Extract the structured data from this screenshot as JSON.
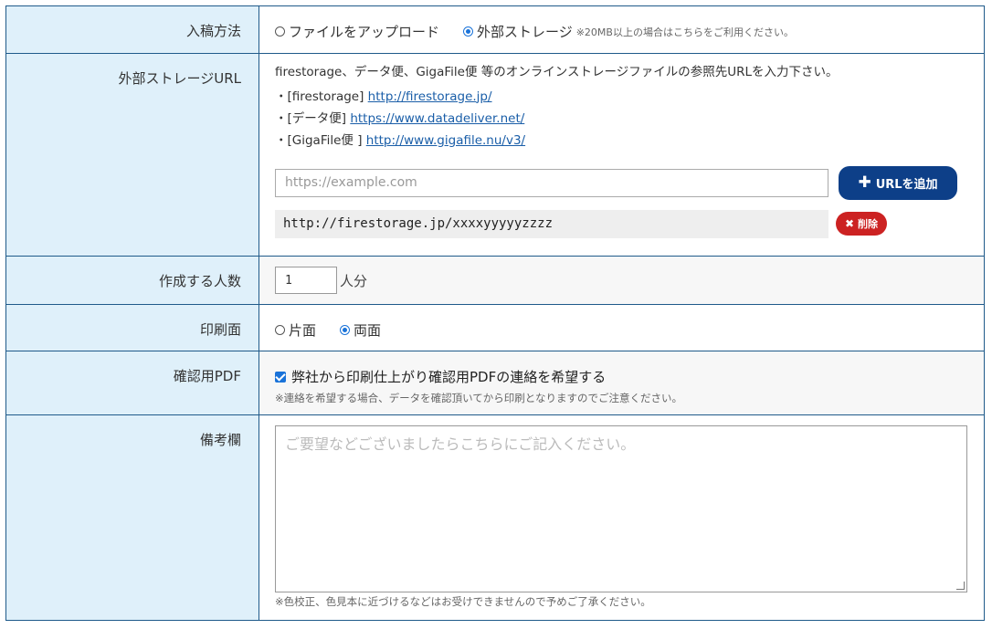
{
  "rows": {
    "upload_method": {
      "label": "入稿方法",
      "option_file": "ファイルをアップロード",
      "option_external": "外部ストレージ",
      "external_note": "※20MB以上の場合はこちらをご利用ください。",
      "selected": "external"
    },
    "external_url": {
      "label": "外部ストレージURL",
      "intro": "firestorage、データ便、GigaFile便 等のオンラインストレージファイルの参照先URLを入力下さい。",
      "links": [
        {
          "prefix": "・[firestorage] ",
          "url": "http://firestorage.jp/"
        },
        {
          "prefix": "・[データ便] ",
          "url": "https://www.datadeliver.net/"
        },
        {
          "prefix": "・[GigaFile便 ] ",
          "url": "http://www.gigafile.nu/v3/"
        }
      ],
      "input_placeholder": "https://example.com",
      "add_button": "URLを追加",
      "saved_url": "http://firestorage.jp/xxxxyyyyyzzzz",
      "delete_button": "削除"
    },
    "people_count": {
      "label": "作成する人数",
      "value": "1",
      "unit": "人分"
    },
    "print_side": {
      "label": "印刷面",
      "option_single": "片面",
      "option_double": "両面",
      "selected": "double"
    },
    "confirm_pdf": {
      "label": "確認用PDF",
      "checkbox_label": "弊社から印刷仕上がり確認用PDFの連絡を希望する",
      "checked": true,
      "note": "※連絡を希望する場合、データを確認頂いてから印刷となりますのでご注意ください。"
    },
    "remarks": {
      "label": "備考欄",
      "placeholder": "ご要望などございましたらこちらにご記入ください。",
      "note": "※色校正、色見本に近づけるなどはお受けできませんので予めご了承ください。"
    }
  },
  "colors": {
    "label_bg": "#dff0fa",
    "border": "#1f5a8a",
    "primary_button": "#0d3f88",
    "danger_button": "#cc2222",
    "radio_checked": "#1a73d9",
    "link": "#1a5ea8"
  }
}
